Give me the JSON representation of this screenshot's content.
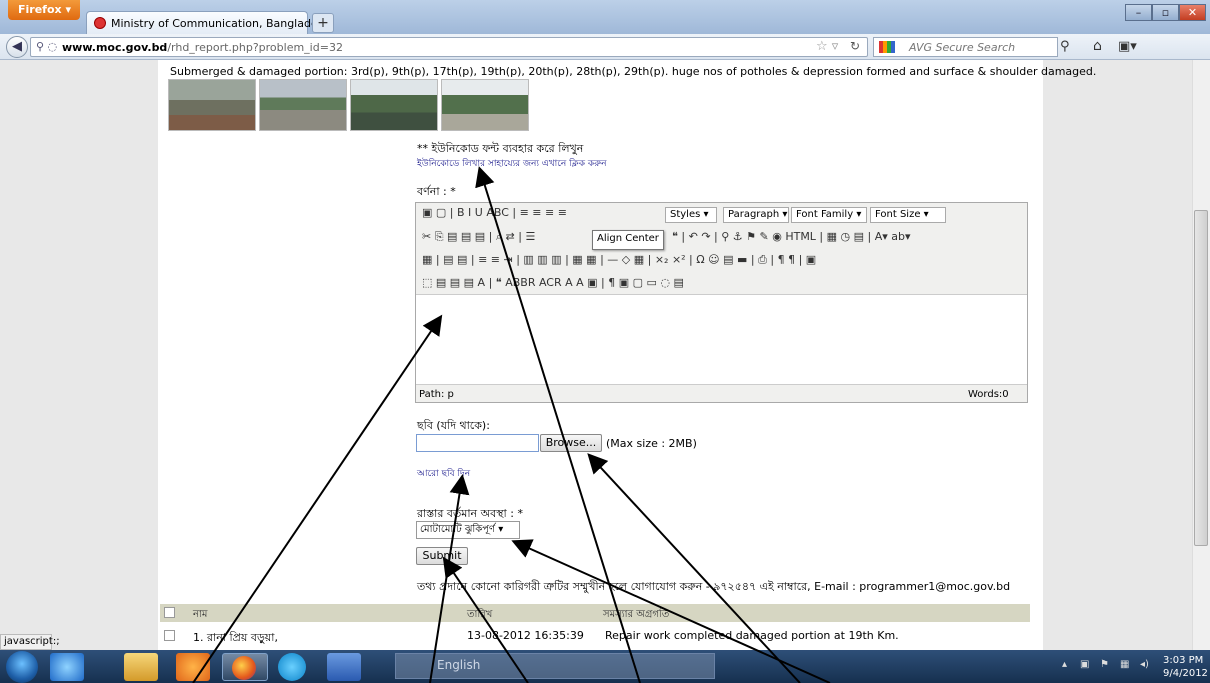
{
  "browser": {
    "app_button": "Firefox",
    "tab_title": "Ministry of Communication, Bangladesh",
    "new_tab": "+",
    "url_host": "www.moc.gov.bd",
    "url_path": "/rhd_report.php?problem_id=32",
    "search_placeholder": "AVG Secure Search",
    "status_text": "javascript:;"
  },
  "report": {
    "intro": "Submerged & damaged portion: 3rd(p), 9th(p), 17th(p), 19th(p), 20th(p), 28th(p), 29th(p). huge nos of potholes & depression formed and surface & shoulder damaged.",
    "unicode_note": "** ইউনিকোড ফন্ট ব্যবহার করে লিখুন",
    "unicode_link": "ইউনিকোডে লিখার সাহায্যের জন্য এখানে ক্লিক করুন",
    "description_label": "বর্ণনা : *"
  },
  "editor": {
    "toolbar_row1": "▣ ▢ | B I U ABC | ≡ ≡ ≡ ≡",
    "toolbar_row2": "✂ ⎘ ▤ ▤ ▤ | ⌕ ⇄ | ☰",
    "toolbar_row3": "▦ | ▤ ▤ | ≡ ≡ ⇥ | ▥ ▥ ▥ | ▦ ▦ | — ◇ ▦ | ×₂ ×² | Ω ☺ ▤ ▬ | ⎙ | ¶ ¶ | ▣",
    "toolbar_row4": "⬚ ▤ ▤ ▤ A | ❝ ABBR ACR A A ▣ | ¶ ▣ ▢ ▭ ◌ ▤",
    "toolbar_row2_tail": "❝ | ↶ ↷ | ⚲ ⚓ ⚑ ✎ ◉ HTML | ▦ ◷ ▤ | A▾ ab▾",
    "styles": "Styles",
    "paragraph": "Paragraph",
    "font_family": "Font Family",
    "font_size": "Font Size",
    "tooltip": "Align Center",
    "path": "Path: p",
    "words": "Words:0"
  },
  "form": {
    "photo_label": "ছবি (যদি থাকে):",
    "browse": "Browse...",
    "max_size": "(Max size : 2MB)",
    "more_photo": "আরো ছবি দিন",
    "road_label": "রাস্তার বর্তমান অবস্থা : *",
    "road_value": "মোটামোটি ঝুকিপূর্ণ",
    "submit": "Submit",
    "info_line": "তথ্য প্রদানে কোনো কারিগরী ত্রুটির সম্মুখীন হলে যোগাযোগ করুন - ৯৭২৫৪৭ এই নাম্বারে, E-mail : programmer1@moc.gov.bd"
  },
  "table": {
    "headers": [
      "নাম",
      "তারিখ",
      "সমস্যার অগ্রগতি"
    ],
    "rows": [
      {
        "name": "1. রানা প্রিয় বড়ুয়া,",
        "date": "13-08-2012 16:35:39",
        "progress": "Repair work completed damaged portion at 19th Km."
      }
    ]
  },
  "taskbar": {
    "language": "English",
    "time": "3:03 PM",
    "date": "9/4/2012"
  },
  "colors": {
    "link": "#1a1a8c",
    "table_header": "#d6d6c2",
    "taskbar": "#1f3d63"
  }
}
